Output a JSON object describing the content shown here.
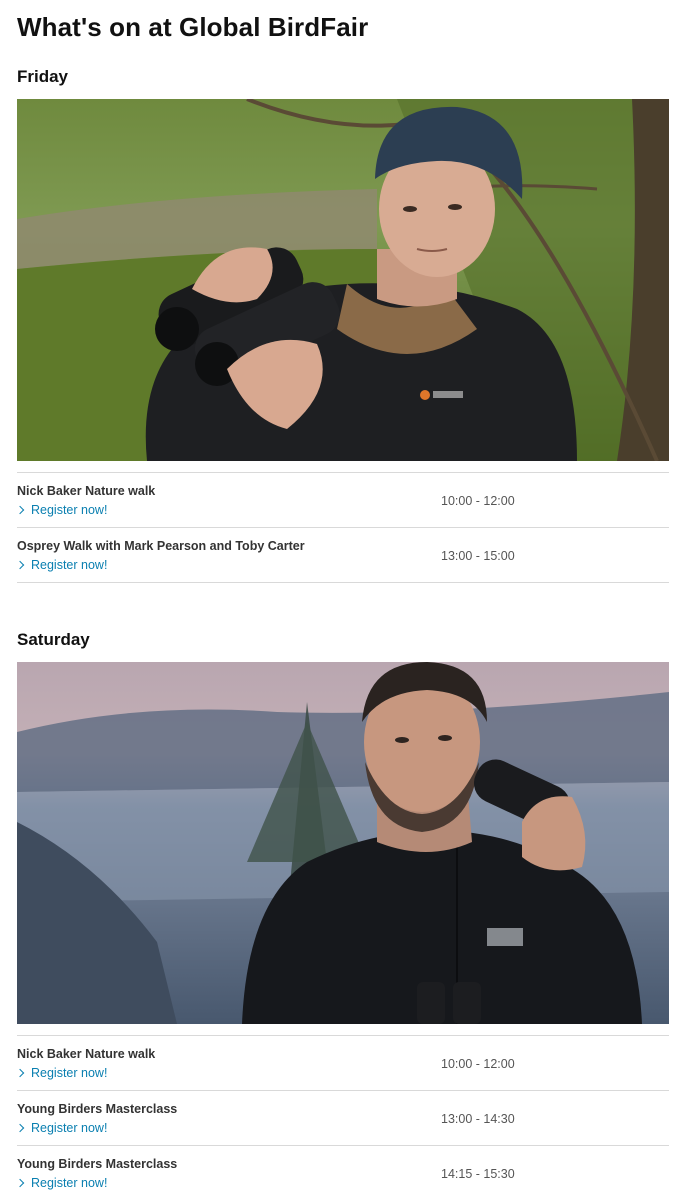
{
  "page": {
    "title": "What's on at Global BirdFair"
  },
  "days": [
    {
      "title": "Friday",
      "image_alt": "Man in beanie holding binoculars in woodland",
      "events": [
        {
          "name": "Nick Baker Nature walk",
          "link": "Register now!",
          "time": "10:00 - 12:00"
        },
        {
          "name": "Osprey Walk with Mark Pearson and Toby Carter",
          "link": "Register now!",
          "time": "13:00 - 15:00"
        }
      ]
    },
    {
      "title": "Saturday",
      "image_alt": "Bearded man holding thermal monocular at dusk",
      "events": [
        {
          "name": "Nick Baker Nature walk",
          "link": "Register now!",
          "time": "10:00 - 12:00"
        },
        {
          "name": "Young Birders Masterclass",
          "link": "Register now!",
          "time": "13:00 - 14:30"
        },
        {
          "name": "Young Birders Masterclass",
          "link": "Register now!",
          "time": "14:15 - 15:30"
        }
      ]
    }
  ],
  "colors": {
    "link": "#0a7fb0",
    "divider": "#d9d9d9",
    "text": "#111111"
  }
}
